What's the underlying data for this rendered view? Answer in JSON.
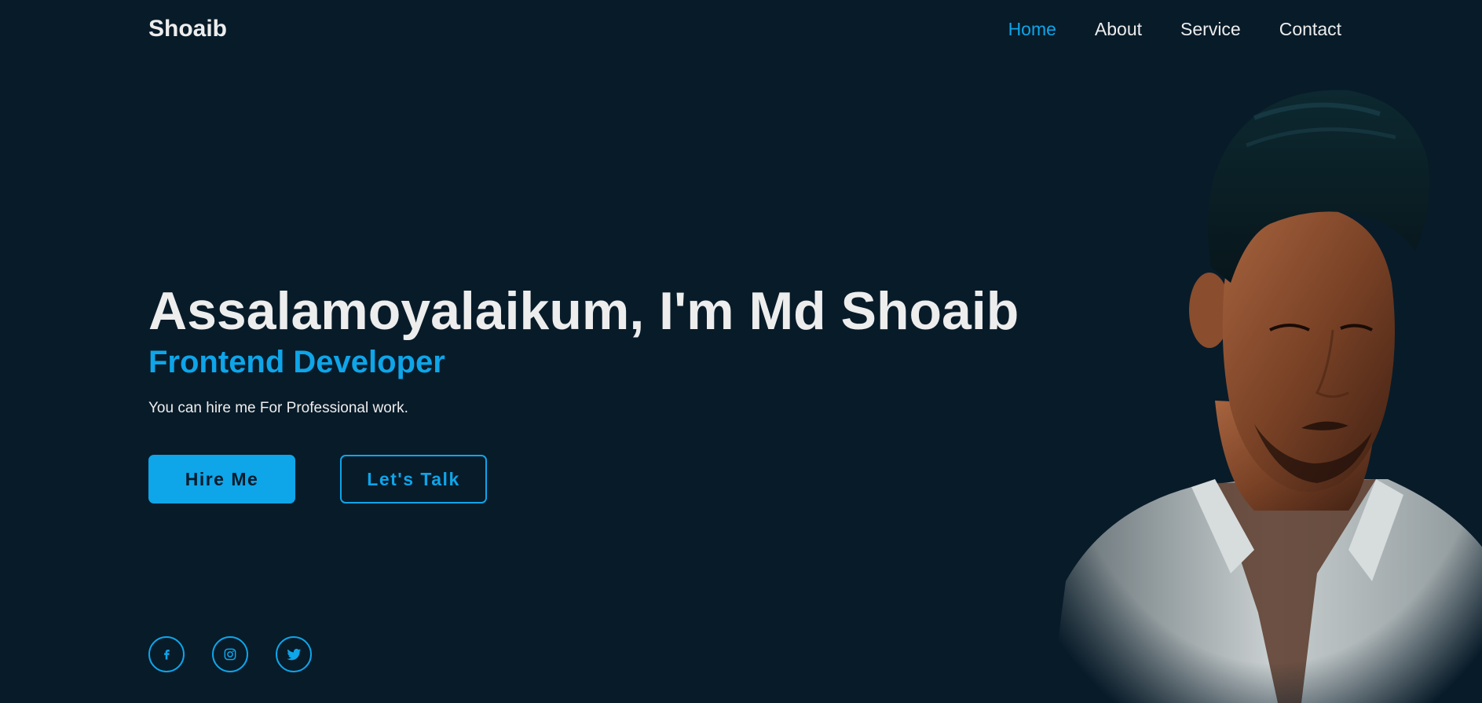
{
  "header": {
    "logo": "Shoaib",
    "nav": [
      {
        "label": "Home",
        "active": true
      },
      {
        "label": "About",
        "active": false
      },
      {
        "label": "Service",
        "active": false
      },
      {
        "label": "Contact",
        "active": false
      }
    ]
  },
  "hero": {
    "title": "Assalamoyalaikum, I'm Md Shoaib",
    "subtitle": "Frontend Developer",
    "description": "You can hire me For Professional work.",
    "primary_button": "Hire Me",
    "secondary_button": "Let's Talk",
    "photo_icon": "portrait-photo"
  },
  "social": [
    {
      "icon": "facebook-icon"
    },
    {
      "icon": "instagram-icon"
    },
    {
      "icon": "twitter-icon"
    }
  ],
  "colors": {
    "background": "#081b29",
    "accent": "#0ea5e9",
    "text": "#ededed"
  }
}
